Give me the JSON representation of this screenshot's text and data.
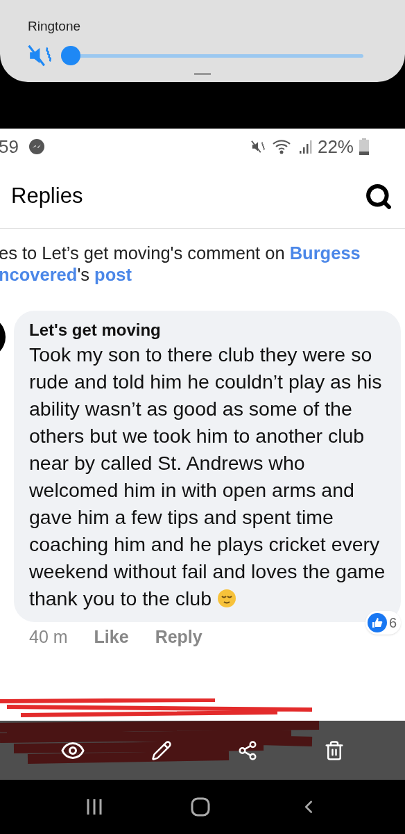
{
  "volume_panel": {
    "label": "Ringtone",
    "muted": true,
    "level": 0
  },
  "screenshot": {
    "status_bar": {
      "time": "59",
      "battery": "22%"
    },
    "header": {
      "title": "Replies"
    },
    "breadcrumb": "es to Let’s get moving's comment on **Burgess ncovered**'s **post**",
    "comment": {
      "author": "Let's get moving",
      "text": "Took my son to there club they were so rude and told him he couldn’t play as his ability wasn’t as good as some of the others but we took him to another club near by called St. Andrews who welcomed him in with open arms and gave him a few tips and spent time coaching him and he plays cricket every weekend without fail and loves the game thank you to the club",
      "time": "40 m",
      "actions": [
        "Like",
        "Reply"
      ],
      "reaction_count": "6"
    }
  }
}
